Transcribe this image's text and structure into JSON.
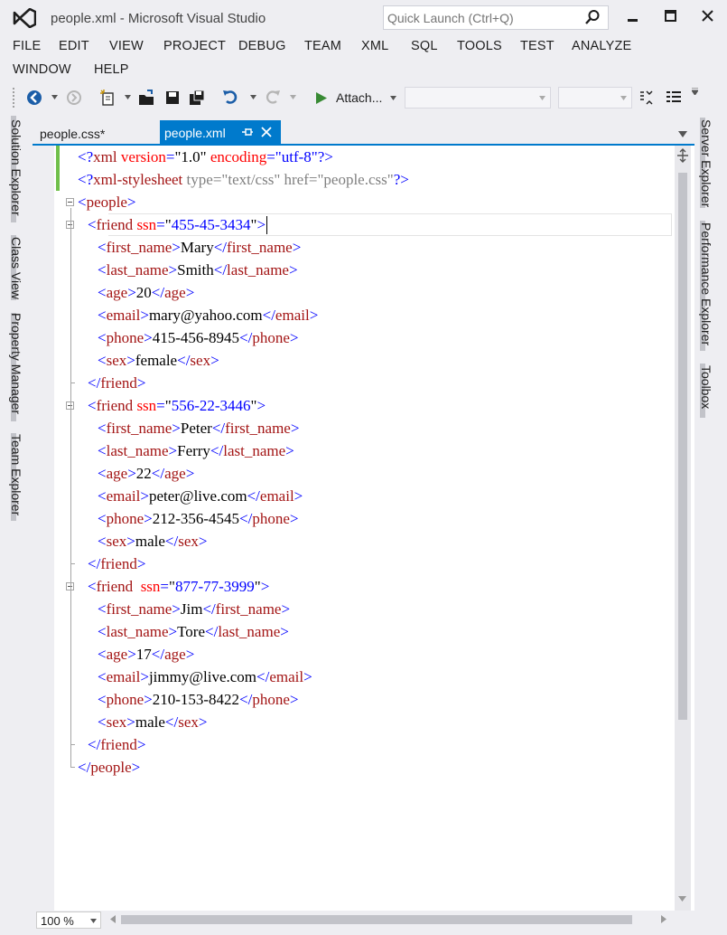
{
  "window": {
    "title": "people.xml - Microsoft Visual Studio",
    "quick_launch_placeholder": "Quick Launch (Ctrl+Q)"
  },
  "menu": {
    "items": [
      "FILE",
      "EDIT",
      "VIEW",
      "PROJECT",
      "DEBUG",
      "TEAM",
      "XML",
      "SQL",
      "TOOLS",
      "TEST",
      "ANALYZE",
      "WINDOW",
      "HELP"
    ]
  },
  "toolbar": {
    "attach_label": "Attach...",
    "config_value": "",
    "platform_value": ""
  },
  "left_panels": [
    "Solution Explorer",
    "Class View",
    "Property Manager",
    "Team Explorer"
  ],
  "right_panels": [
    "Server Explorer",
    "Performance Explorer",
    "Toolbox"
  ],
  "tabs": [
    {
      "label": "people.css*",
      "active": false
    },
    {
      "label": "people.xml",
      "active": true
    }
  ],
  "editor": {
    "lines": [
      [
        [
          "<?",
          "blue"
        ],
        [
          "xml",
          "red"
        ],
        [
          " ",
          "black"
        ],
        [
          "version",
          "bred"
        ],
        [
          "=",
          "blue"
        ],
        [
          "\"1.0\"",
          "black"
        ],
        [
          " ",
          "black"
        ],
        [
          "encoding",
          "bred"
        ],
        [
          "=",
          "blue"
        ],
        [
          "\"utf-8\"",
          "attrval"
        ],
        [
          "?>",
          "blue"
        ]
      ],
      [
        [
          "<?",
          "blue"
        ],
        [
          "xml-stylesheet",
          "red"
        ],
        [
          " type=\"text/css\" href=\"people.css\"",
          "gray"
        ],
        [
          "?>",
          "blue"
        ]
      ],
      [
        [
          "<",
          "blue"
        ],
        [
          "people",
          "red"
        ],
        [
          ">",
          "blue"
        ]
      ],
      [
        [
          "<",
          "blue"
        ],
        [
          "friend",
          "red"
        ],
        [
          " ",
          "black"
        ],
        [
          "ssn",
          "bred"
        ],
        [
          "=",
          "blue"
        ],
        [
          "\"",
          "black"
        ],
        [
          "455-45-3434",
          "attrval"
        ],
        [
          "\"",
          "black"
        ],
        [
          ">",
          "blue"
        ]
      ],
      [
        [
          "<",
          "blue"
        ],
        [
          "first_name",
          "red"
        ],
        [
          ">",
          "blue"
        ],
        [
          "Mary",
          "black"
        ],
        [
          "</",
          "blue"
        ],
        [
          "first_name",
          "red"
        ],
        [
          ">",
          "blue"
        ]
      ],
      [
        [
          "<",
          "blue"
        ],
        [
          "last_name",
          "red"
        ],
        [
          ">",
          "blue"
        ],
        [
          "Smith",
          "black"
        ],
        [
          "</",
          "blue"
        ],
        [
          "last_name",
          "red"
        ],
        [
          ">",
          "blue"
        ]
      ],
      [
        [
          "<",
          "blue"
        ],
        [
          "age",
          "red"
        ],
        [
          ">",
          "blue"
        ],
        [
          "20",
          "black"
        ],
        [
          "</",
          "blue"
        ],
        [
          "age",
          "red"
        ],
        [
          ">",
          "blue"
        ]
      ],
      [
        [
          "<",
          "blue"
        ],
        [
          "email",
          "red"
        ],
        [
          ">",
          "blue"
        ],
        [
          "mary@yahoo.com",
          "black"
        ],
        [
          "</",
          "blue"
        ],
        [
          "email",
          "red"
        ],
        [
          ">",
          "blue"
        ]
      ],
      [
        [
          "<",
          "blue"
        ],
        [
          "phone",
          "red"
        ],
        [
          ">",
          "blue"
        ],
        [
          "415-456-8945",
          "black"
        ],
        [
          "</",
          "blue"
        ],
        [
          "phone",
          "red"
        ],
        [
          ">",
          "blue"
        ]
      ],
      [
        [
          "<",
          "blue"
        ],
        [
          "sex",
          "red"
        ],
        [
          ">",
          "blue"
        ],
        [
          "female",
          "black"
        ],
        [
          "</",
          "blue"
        ],
        [
          "sex",
          "red"
        ],
        [
          ">",
          "blue"
        ]
      ],
      [
        [
          "</",
          "blue"
        ],
        [
          "friend",
          "red"
        ],
        [
          ">",
          "blue"
        ]
      ],
      [
        [
          "<",
          "blue"
        ],
        [
          "friend",
          "red"
        ],
        [
          " ",
          "black"
        ],
        [
          "ssn",
          "bred"
        ],
        [
          "=",
          "blue"
        ],
        [
          "\"",
          "black"
        ],
        [
          "556-22-3446",
          "attrval"
        ],
        [
          "\"",
          "black"
        ],
        [
          ">",
          "blue"
        ]
      ],
      [
        [
          "<",
          "blue"
        ],
        [
          "first_name",
          "red"
        ],
        [
          ">",
          "blue"
        ],
        [
          "Peter",
          "black"
        ],
        [
          "</",
          "blue"
        ],
        [
          "first_name",
          "red"
        ],
        [
          ">",
          "blue"
        ]
      ],
      [
        [
          "<",
          "blue"
        ],
        [
          "last_name",
          "red"
        ],
        [
          ">",
          "blue"
        ],
        [
          "Ferry",
          "black"
        ],
        [
          "</",
          "blue"
        ],
        [
          "last_name",
          "red"
        ],
        [
          ">",
          "blue"
        ]
      ],
      [
        [
          "<",
          "blue"
        ],
        [
          "age",
          "red"
        ],
        [
          ">",
          "blue"
        ],
        [
          "22",
          "black"
        ],
        [
          "</",
          "blue"
        ],
        [
          "age",
          "red"
        ],
        [
          ">",
          "blue"
        ]
      ],
      [
        [
          "<",
          "blue"
        ],
        [
          "email",
          "red"
        ],
        [
          ">",
          "blue"
        ],
        [
          "peter@live.com",
          "black"
        ],
        [
          "</",
          "blue"
        ],
        [
          "email",
          "red"
        ],
        [
          ">",
          "blue"
        ]
      ],
      [
        [
          "<",
          "blue"
        ],
        [
          "phone",
          "red"
        ],
        [
          ">",
          "blue"
        ],
        [
          "212-356-4545",
          "black"
        ],
        [
          "</",
          "blue"
        ],
        [
          "phone",
          "red"
        ],
        [
          ">",
          "blue"
        ]
      ],
      [
        [
          "<",
          "blue"
        ],
        [
          "sex",
          "red"
        ],
        [
          ">",
          "blue"
        ],
        [
          "male",
          "black"
        ],
        [
          "</",
          "blue"
        ],
        [
          "sex",
          "red"
        ],
        [
          ">",
          "blue"
        ]
      ],
      [
        [
          "</",
          "blue"
        ],
        [
          "friend",
          "red"
        ],
        [
          ">",
          "blue"
        ]
      ],
      [
        [
          "<",
          "blue"
        ],
        [
          "friend",
          "red"
        ],
        [
          "  ",
          "black"
        ],
        [
          "ssn",
          "bred"
        ],
        [
          "=",
          "blue"
        ],
        [
          "\"",
          "black"
        ],
        [
          "877-77-3999",
          "attrval"
        ],
        [
          "\"",
          "black"
        ],
        [
          ">",
          "blue"
        ]
      ],
      [
        [
          "<",
          "blue"
        ],
        [
          "first_name",
          "red"
        ],
        [
          ">",
          "blue"
        ],
        [
          "Jim",
          "black"
        ],
        [
          "</",
          "blue"
        ],
        [
          "first_name",
          "red"
        ],
        [
          ">",
          "blue"
        ]
      ],
      [
        [
          "<",
          "blue"
        ],
        [
          "last_name",
          "red"
        ],
        [
          ">",
          "blue"
        ],
        [
          "Tore",
          "black"
        ],
        [
          "</",
          "blue"
        ],
        [
          "last_name",
          "red"
        ],
        [
          ">",
          "blue"
        ]
      ],
      [
        [
          "<",
          "blue"
        ],
        [
          "age",
          "red"
        ],
        [
          ">",
          "blue"
        ],
        [
          "17",
          "black"
        ],
        [
          "</",
          "blue"
        ],
        [
          "age",
          "red"
        ],
        [
          ">",
          "blue"
        ]
      ],
      [
        [
          "<",
          "blue"
        ],
        [
          "email",
          "red"
        ],
        [
          ">",
          "blue"
        ],
        [
          "jimmy@live.com",
          "black"
        ],
        [
          "</",
          "blue"
        ],
        [
          "email",
          "red"
        ],
        [
          ">",
          "blue"
        ]
      ],
      [
        [
          "<",
          "blue"
        ],
        [
          "phone",
          "red"
        ],
        [
          ">",
          "blue"
        ],
        [
          "210-153-8422",
          "black"
        ],
        [
          "</",
          "blue"
        ],
        [
          "phone",
          "red"
        ],
        [
          ">",
          "blue"
        ]
      ],
      [
        [
          "<",
          "blue"
        ],
        [
          "sex",
          "red"
        ],
        [
          ">",
          "blue"
        ],
        [
          "male",
          "black"
        ],
        [
          "</",
          "blue"
        ],
        [
          "sex",
          "red"
        ],
        [
          ">",
          "blue"
        ]
      ],
      [
        [
          "</",
          "blue"
        ],
        [
          "friend",
          "red"
        ],
        [
          ">",
          "blue"
        ]
      ],
      [
        [
          "</",
          "blue"
        ],
        [
          "people",
          "red"
        ],
        [
          ">",
          "blue"
        ]
      ]
    ],
    "indent_levels": [
      0,
      0,
      0,
      1,
      2,
      2,
      2,
      2,
      2,
      2,
      1,
      1,
      2,
      2,
      2,
      2,
      2,
      2,
      1,
      1,
      2,
      2,
      2,
      2,
      2,
      2,
      1,
      0
    ]
  },
  "status": {
    "zoom": "100 %"
  },
  "colors": {
    "accent": "#007acc",
    "tag_bracket": "#0000ff",
    "tag_name": "#a31515",
    "attr_name": "#ff0000",
    "change_bar": "#6fbf4a"
  }
}
